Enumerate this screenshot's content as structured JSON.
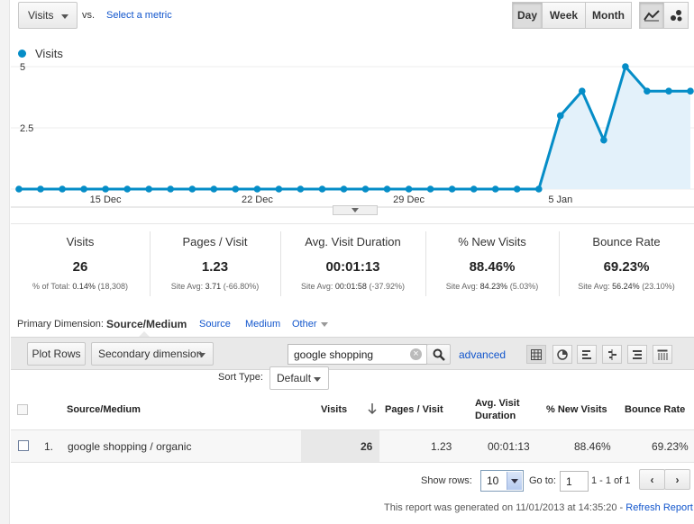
{
  "toolbar": {
    "metric_select": "Visits",
    "vs_label": "vs.",
    "select_metric_link": "Select a metric",
    "periods": [
      "Day",
      "Week",
      "Month"
    ],
    "active_period": "Day"
  },
  "chart_data": {
    "type": "area",
    "series": [
      {
        "name": "Visits",
        "color": "#058dc7",
        "values": [
          0,
          0,
          0,
          0,
          0,
          0,
          0,
          0,
          0,
          0,
          0,
          0,
          0,
          0,
          0,
          0,
          0,
          0,
          0,
          0,
          0,
          0,
          0,
          0,
          0,
          3,
          4,
          2,
          5,
          4,
          4,
          4
        ]
      }
    ],
    "x_tick_labels": [
      "15 Dec",
      "22 Dec",
      "29 Dec",
      "5 Jan"
    ],
    "y_tick_labels": [
      "5",
      "2.5"
    ],
    "ylim": [
      0,
      5
    ],
    "legend": "top-left"
  },
  "metrics": [
    {
      "title": "Visits",
      "value": "26",
      "sub_prefix": "% of Total:",
      "sub_bold": "0.14%",
      "sub_suffix": "(18,308)"
    },
    {
      "title": "Pages / Visit",
      "value": "1.23",
      "sub_prefix": "Site Avg:",
      "sub_bold": "3.71",
      "sub_suffix": "(-66.80%)"
    },
    {
      "title": "Avg. Visit Duration",
      "value": "00:01:13",
      "sub_prefix": "Site Avg:",
      "sub_bold": "00:01:58",
      "sub_suffix": "(-37.92%)"
    },
    {
      "title": "% New Visits",
      "value": "88.46%",
      "sub_prefix": "Site Avg:",
      "sub_bold": "84.23%",
      "sub_suffix": "(5.03%)"
    },
    {
      "title": "Bounce Rate",
      "value": "69.23%",
      "sub_prefix": "Site Avg:",
      "sub_bold": "56.24%",
      "sub_suffix": "(23.10%)"
    }
  ],
  "dimensions": {
    "label": "Primary Dimension:",
    "active": "Source/Medium",
    "links": [
      "Source",
      "Medium",
      "Other"
    ]
  },
  "table_controls": {
    "plot_rows": "Plot Rows",
    "secondary_dimension": "Secondary dimension",
    "search_value": "google shopping",
    "advanced_link": "advanced",
    "sort_type_label": "Sort Type:",
    "sort_type_value": "Default"
  },
  "table": {
    "headers": [
      "Source/Medium",
      "Visits",
      "Pages / Visit",
      "Avg. Visit",
      "Duration",
      "% New Visits",
      "Bounce Rate"
    ],
    "rows": [
      {
        "index": "1.",
        "source": "google shopping / organic",
        "visits": "26",
        "pages": "1.23",
        "duration": "00:01:13",
        "new_visits": "88.46%",
        "bounce": "69.23%"
      }
    ]
  },
  "pagination": {
    "show_rows_label": "Show rows:",
    "show_rows_value": "10",
    "goto_label": "Go to:",
    "goto_value": "1",
    "range": "1 - 1 of 1"
  },
  "footer": {
    "generated_text": "This report was generated on 11/01/2013 at 14:35:20 -",
    "refresh_link": "Refresh Report"
  }
}
